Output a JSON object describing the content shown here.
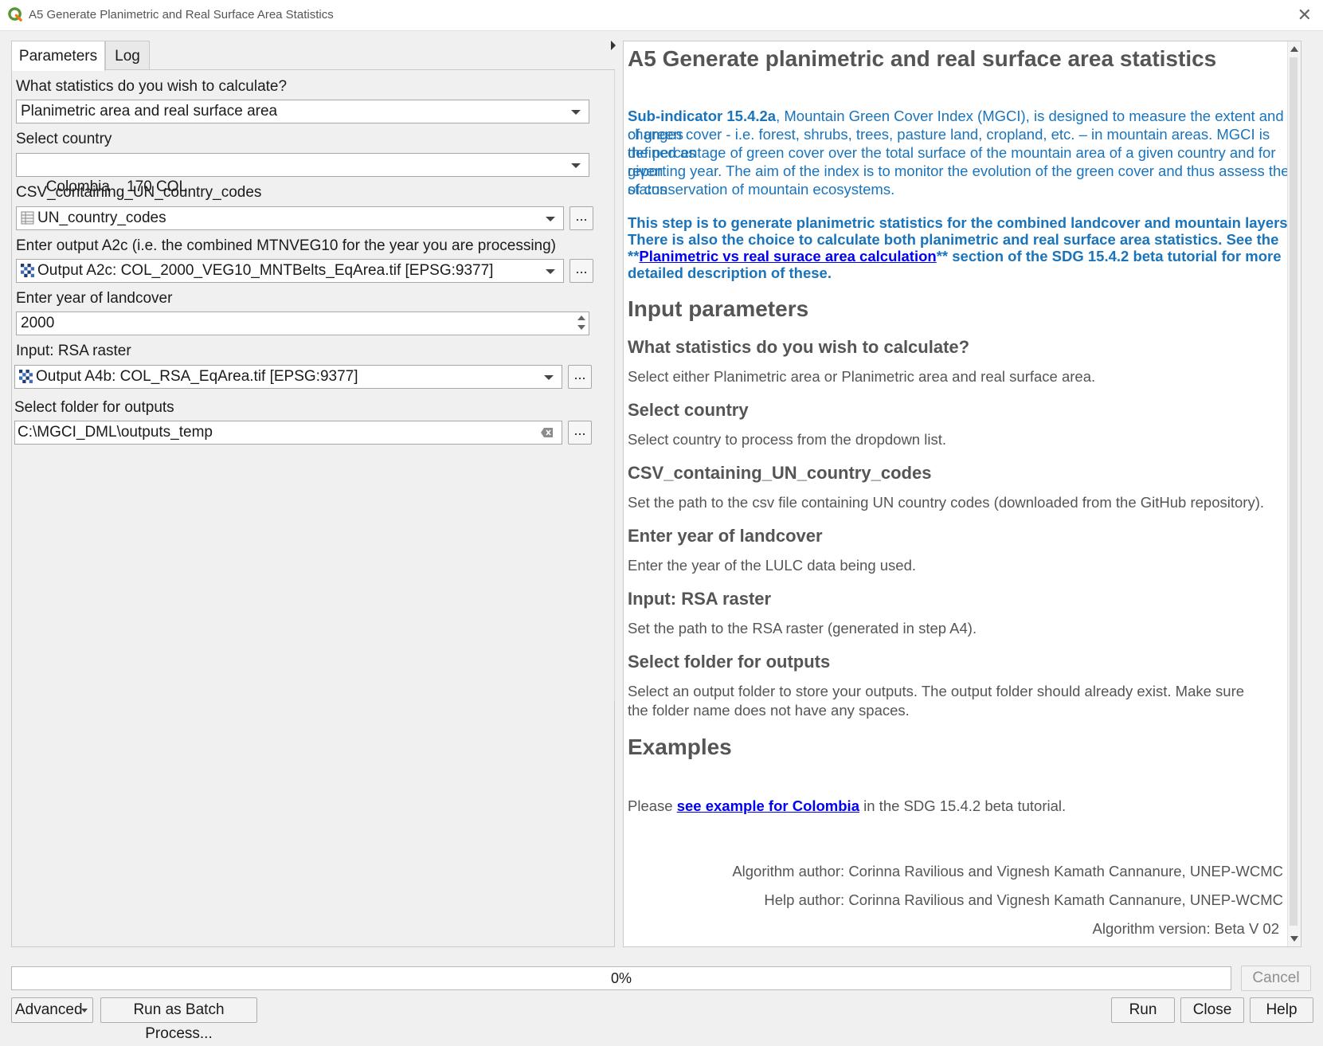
{
  "window": {
    "title": "A5 Generate Planimetric and Real Surface Area Statistics",
    "close_glyph": "✕"
  },
  "tabs": [
    {
      "label": "Parameters"
    },
    {
      "label": "Log"
    }
  ],
  "params": {
    "stats_label": "What statistics do you wish to calculate?",
    "stats_value": "Planimetric area and real surface area",
    "country_label": "Select country",
    "country_value": "Colombia    170 COL",
    "csv_label": "CSV_containing_UN_country_codes",
    "csv_value": "UN_country_codes",
    "a2c_label": "Enter output A2c (i.e.  the  combined MTNVEG10 for the year you are processing)",
    "a2c_value": "Output A2c: COL_2000_VEG10_MNTBelts_EqArea.tif [EPSG:9377]",
    "year_label": "Enter year of landcover",
    "year_value": "2000",
    "rsa_label": "Input: RSA raster",
    "rsa_value": "Output A4b: COL_RSA_EqArea.tif [EPSG:9377]",
    "folder_label": "Select folder for outputs",
    "folder_value": "C:\\MGCI_DML\\outputs_temp",
    "browse_label": "..."
  },
  "help": {
    "title": "A5 Generate planimetric and real surface area statistics",
    "sub_bold": "Sub-indicator 15.4.2a",
    "sub_rest_1": ", Mountain Green Cover Index (MGCI), is designed to measure the extent and changes",
    "sub_line_2": "of green cover - i.e. forest, shrubs, trees, pasture land, cropland, etc. – in mountain areas. MGCI is defined as",
    "sub_line_3": "the percentage of green cover over the total surface of the mountain area of a given country and for given",
    "sub_line_4": "reporting year. The aim of the index is to monitor the evolution of the green cover and thus assess the status",
    "sub_line_5": "of conservation of mountain ecosystems.",
    "step_line_1": "This step is to generate planimetric statistics for the combined landcover and mountain layers.",
    "step_line_2": "There is also the choice to calculate both planimetric and real surface area statistics.  See the",
    "step_line_3_pre": "**",
    "step_link": "Planimetric vs real surace area calculation",
    "step_line_3_post": "** section of the SDG 15.4.2 beta tutorial for more",
    "step_line_4": "detailed description of these.",
    "input_params": "Input parameters",
    "q1": "What statistics do you wish to calculate?",
    "a1": "Select either Planimetric area or Planimetric area and real surface area.",
    "q2": "Select country",
    "a2": "Select country to process from the dropdown list.",
    "q3": "CSV_containing_UN_country_codes",
    "a3": "Set the path to the csv file containing UN country codes (downloaded from the GitHub repository).",
    "q4": "Enter year of landcover",
    "a4": "Enter the year of the LULC data being used.",
    "q5": "Input: RSA raster",
    "a5": "Set the path to the RSA raster (generated in step A4).",
    "q6": "Select folder for outputs",
    "a6_1": "Select an output folder to store your outputs. The output folder should already exist. Make sure",
    "a6_2": "the folder name does not have any spaces.",
    "examples": "Examples",
    "ex_pre": "Please ",
    "ex_link": "see example for Colombia",
    "ex_post": " in the SDG 15.4.2 beta tutorial.",
    "alg_author": "Algorithm author: Corinna Ravilious and Vignesh Kamath Cannanure, UNEP-WCMC",
    "help_author": "Help author: Corinna Ravilious and Vignesh Kamath Cannanure, UNEP-WCMC",
    "alg_version": "Algorithm version: Beta V 02"
  },
  "progress": {
    "text": "0%",
    "value": 0
  },
  "buttons": {
    "cancel": "Cancel",
    "advanced": "Advanced",
    "batch": "Run as Batch Process...",
    "run": "Run",
    "close": "Close",
    "help": "Help"
  },
  "colors": {
    "accent_blue": "#1a74bb",
    "link": "#0000ee",
    "qgis_green": "#589632"
  }
}
